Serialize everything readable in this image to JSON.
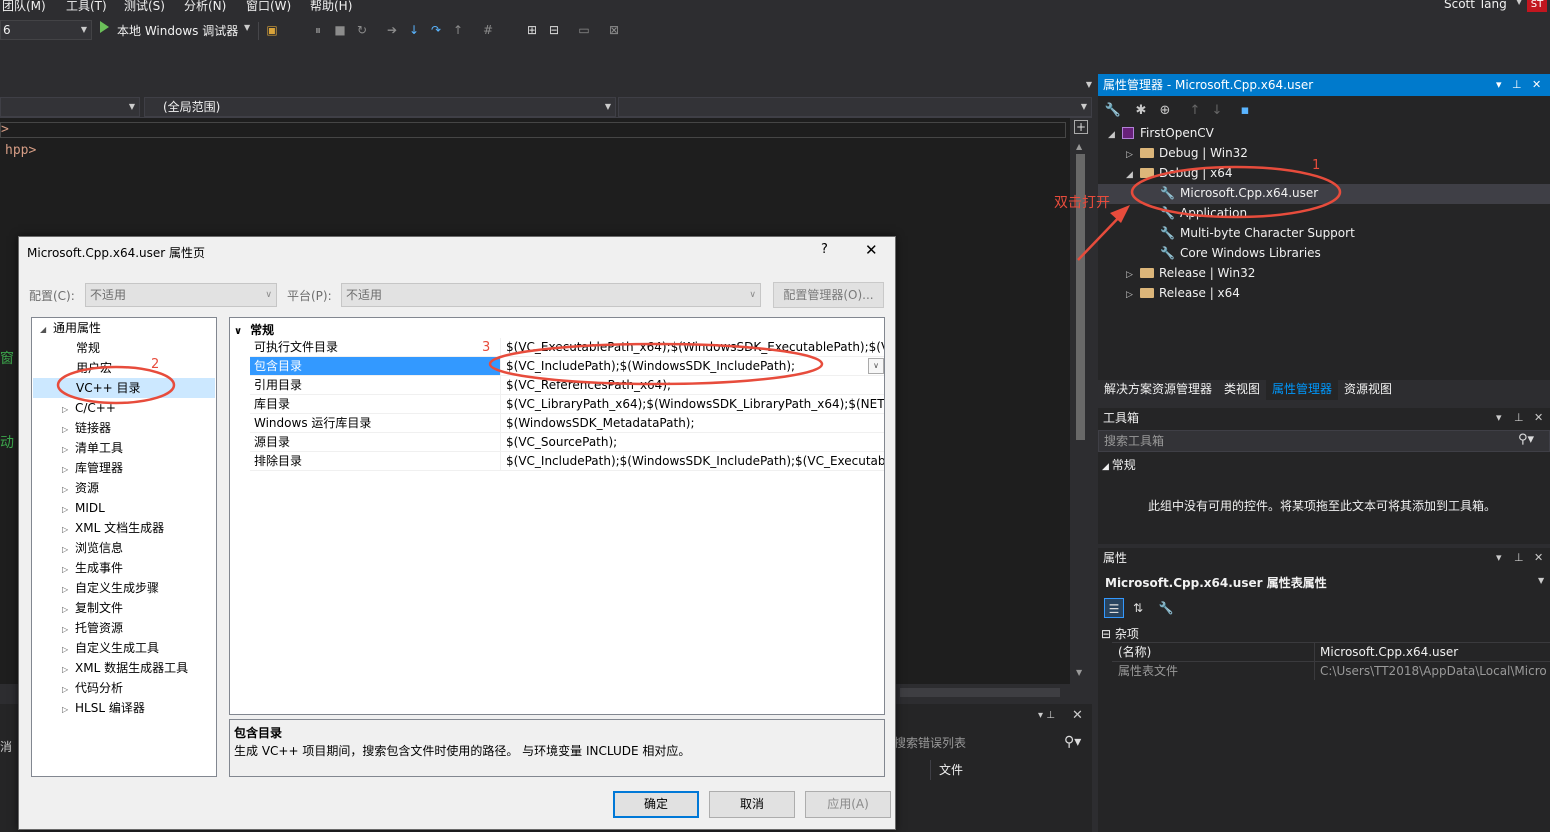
{
  "menu": [
    "团队(M)",
    "工具(T)",
    "测试(S)",
    "分析(N)",
    "窗口(W)",
    "帮助(H)"
  ],
  "user": {
    "name": "Scott Tang",
    "initials": "ST"
  },
  "toolbar": {
    "config_value": "6",
    "run_label": "本地 Windows 调试器"
  },
  "nav": {
    "scope": "(全局范围)"
  },
  "editor": {
    "line1": ">",
    "line2": "hpp>",
    "frag1": "窗",
    "frag2": "动"
  },
  "error_list": {
    "search_placeholder": "搜索错误列表",
    "col_file": "文件",
    "left_label": "消"
  },
  "property_manager": {
    "title": "属性管理器 - Microsoft.Cpp.x64.user",
    "tree": {
      "project": "FirstOpenCV",
      "debug_win32": "Debug | Win32",
      "debug_x64": "Debug | x64",
      "items": [
        "Microsoft.Cpp.x64.user",
        "Application",
        "Multi-byte Character Support",
        "Core Windows Libraries"
      ],
      "release_win32": "Release | Win32",
      "release_x64": "Release | x64"
    }
  },
  "right_tabs": [
    "解决方案资源管理器",
    "类视图",
    "属性管理器",
    "资源视图"
  ],
  "toolbox": {
    "title": "工具箱",
    "search_placeholder": "搜索工具箱",
    "group": "常规",
    "empty_text": "此组中没有可用的控件。将某项拖至此文本可将其添加到工具箱。"
  },
  "properties": {
    "title": "属性",
    "object": "Microsoft.Cpp.x64.user  属性表属性",
    "category": "杂项",
    "rows": [
      {
        "key": "(名称)",
        "value": "Microsoft.Cpp.x64.user"
      },
      {
        "key": "属性表文件",
        "value": "C:\\Users\\TT2018\\AppData\\Local\\Micro"
      }
    ]
  },
  "dialog": {
    "title": "Microsoft.Cpp.x64.user 属性页",
    "help": "?",
    "config_label": "配置(C):",
    "config_value": "不适用",
    "platform_label": "平台(P):",
    "platform_value": "不适用",
    "config_manager": "配置管理器(O)...",
    "tree": {
      "root": "通用属性",
      "items": [
        "常规",
        "用户宏",
        "VC++ 目录",
        "C/C++",
        "链接器",
        "清单工具",
        "库管理器",
        "资源",
        "MIDL",
        "XML 文档生成器",
        "浏览信息",
        "生成事件",
        "自定义生成步骤",
        "复制文件",
        "托管资源",
        "自定义生成工具",
        "XML 数据生成器工具",
        "代码分析",
        "HLSL 编译器"
      ]
    },
    "grid": {
      "section": "常规",
      "rows": [
        {
          "key": "可执行文件目录",
          "value": "$(VC_ExecutablePath_x64);$(WindowsSDK_ExecutablePath);$(VS_E"
        },
        {
          "key": "包含目录",
          "value": "$(VC_IncludePath);$(WindowsSDK_IncludePath);"
        },
        {
          "key": "引用目录",
          "value": "$(VC_ReferencesPath_x64);"
        },
        {
          "key": "库目录",
          "value": "$(VC_LibraryPath_x64);$(WindowsSDK_LibraryPath_x64);$(NETFXK"
        },
        {
          "key": "Windows 运行库目录",
          "value": "$(WindowsSDK_MetadataPath);"
        },
        {
          "key": "源目录",
          "value": "$(VC_SourcePath);"
        },
        {
          "key": "排除目录",
          "value": "$(VC_IncludePath);$(WindowsSDK_IncludePath);$(VC_ExecutablePa"
        }
      ]
    },
    "desc_title": "包含目录",
    "desc_text": "生成 VC++ 项目期间，搜索包含文件时使用的路径。  与环境变量 INCLUDE 相对应。",
    "ok": "确定",
    "cancel": "取消",
    "apply": "应用(A)"
  },
  "annotations": {
    "dblclick": "双击打开",
    "n1": "1",
    "n2": "2",
    "n3": "3"
  },
  "colors": {
    "accent": "#007acc",
    "selection": "#3399ff",
    "annotation": "#e74c3c",
    "bg_dark": "#2d2d30"
  }
}
